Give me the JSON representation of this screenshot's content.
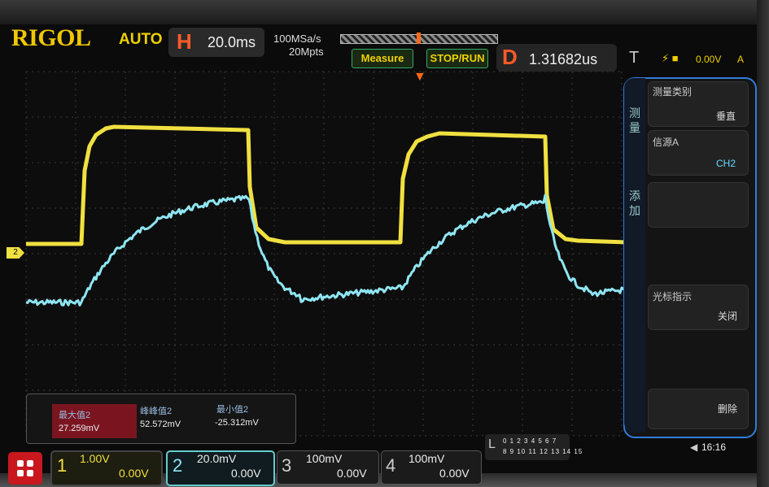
{
  "header": {
    "logo": "RIGOL",
    "trigger_mode": "AUTO",
    "h_label": "H",
    "timebase": "20.0ms",
    "sample_rate": "100MSa/s",
    "memory_depth": "20Mpts",
    "measure_label": "Measure",
    "stop_run_label": "STOP/RUN",
    "d_label": "D",
    "delay": "1.31682us",
    "t_label": "T",
    "trigger_level": "0.00V",
    "trigger_channel": "A"
  },
  "colors": {
    "ch1": "#f0e040",
    "ch2": "#7fe0f0",
    "accent": "#f0d000",
    "panel_border": "#2f7dd8"
  },
  "side_menu": {
    "tab_top": "测量",
    "tab_mid": "添加",
    "meas_type_label": "测量类别",
    "meas_type_value": "垂直",
    "source_label": "信源A",
    "source_value": "CH2",
    "cursor_label": "光标指示",
    "cursor_value": "关闭",
    "delete_label": "删除"
  },
  "measurements": {
    "max_label": "最大值2",
    "max_value": "27.259mV",
    "pp_label": "峰峰值2",
    "pp_value": "52.572mV",
    "min_label": "最小值2",
    "min_value": "-25.312mV"
  },
  "channels": [
    {
      "num": "1",
      "scale": "1.00V",
      "offset": "0.00V"
    },
    {
      "num": "2",
      "scale": "20.0mV",
      "offset": "0.00V"
    },
    {
      "num": "3",
      "scale": "100mV",
      "offset": "0.00V"
    },
    {
      "num": "4",
      "scale": "100mV",
      "offset": "0.00V"
    }
  ],
  "logic": {
    "label": "L",
    "row1": "0 1 2 3 4 5 6 7",
    "row2": "8 9 10 11 12 13 14 15"
  },
  "clock": "16:16",
  "ch2_marker": "2"
}
